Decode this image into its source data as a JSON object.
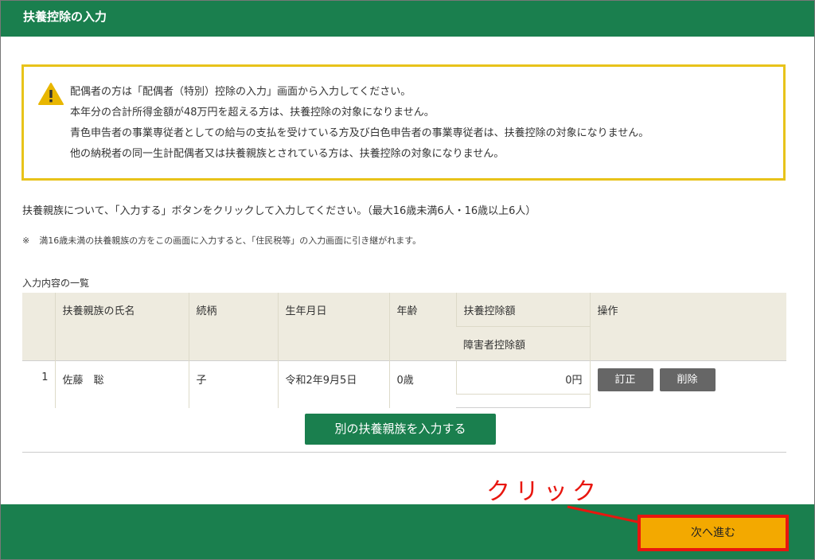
{
  "header": {
    "title": "扶養控除の入力"
  },
  "warning": {
    "icon": "warning-icon",
    "lines": [
      "配偶者の方は「配偶者（特別）控除の入力」画面から入力してください。",
      "本年分の合計所得金額が48万円を超える方は、扶養控除の対象になりません。",
      "青色申告者の事業専従者としての給与の支払を受けている方及び白色申告者の事業専従者は、扶養控除の対象になりません。",
      "他の納税者の同一生計配偶者又は扶養親族とされている方は、扶養控除の対象になりません。"
    ]
  },
  "instruction": "扶養親族について、「入力する」ボタンをクリックして入力してください。（最大16歳未満6人・16歳以上6人）",
  "note": {
    "mark": "※",
    "text": "満16歳未満の扶養親族の方をこの画面に入力すると、「住民税等」の入力画面に引き継がれます。"
  },
  "list": {
    "caption": "入力内容の一覧",
    "headers": {
      "name": "扶養親族の氏名",
      "relation": "続柄",
      "birth": "生年月日",
      "age": "年齢",
      "deduction": "扶養控除額",
      "disability": "障害者控除額",
      "ops": "操作"
    },
    "rows": [
      {
        "no": "1",
        "name": "佐藤　聡",
        "relation": "子",
        "birth": "令和2年9月5日",
        "age": "0歳",
        "deduction": "0円",
        "disability": "",
        "edit_label": "訂正",
        "delete_label": "削除"
      }
    ]
  },
  "add_button": "別の扶養親族を入力する",
  "next_button": "次へ進む",
  "annotation": {
    "click_text": "クリック"
  },
  "colors": {
    "header_green": "#1a7f4e",
    "warning_border": "#e8c31a",
    "next_button": "#f3a900",
    "highlight_red": "#e8160f"
  }
}
